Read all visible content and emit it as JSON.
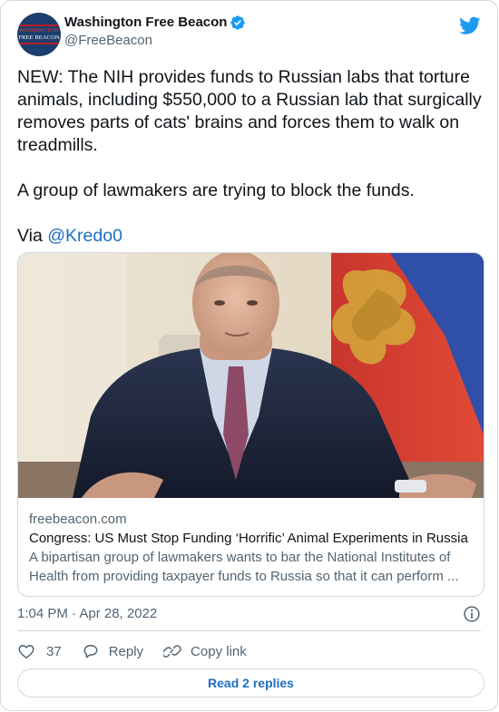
{
  "account": {
    "display_name": "Washington Free Beacon",
    "handle": "@FreeBeacon",
    "avatar_line1": "WASHINGTON",
    "avatar_line2": "FREE BEACON"
  },
  "tweet": {
    "paragraph1": "NEW: The NIH provides funds to Russian labs that torture animals, including $550,000 to a Russian lab that surgically removes parts of cats' brains and forces them to walk on treadmills.",
    "paragraph2": "A group of lawmakers are trying to block the funds.",
    "via_label": "Via ",
    "mention": "@Kredo0"
  },
  "card": {
    "domain": "freebeacon.com",
    "title": "Congress: US Must Stop Funding ‘Horrific’ Animal Experiments in Russia",
    "description": "A bipartisan group of lawmakers wants to bar the National Institutes of Health from providing taxpayer funds to Russia so that it can perform ..."
  },
  "meta": {
    "timestamp": "1:04 PM · Apr 28, 2022"
  },
  "actions": {
    "like_count": "37",
    "reply_label": "Reply",
    "copy_link_label": "Copy link"
  },
  "read_replies_label": "Read 2 replies",
  "colors": {
    "accent": "#1d6ec2",
    "twitter_blue": "#1d9bf0",
    "muted": "#536471",
    "border": "#cfd9de"
  },
  "icons": [
    "verified-badge-icon",
    "twitter-bird-icon",
    "info-icon",
    "heart-icon",
    "reply-bubble-icon",
    "link-icon"
  ]
}
